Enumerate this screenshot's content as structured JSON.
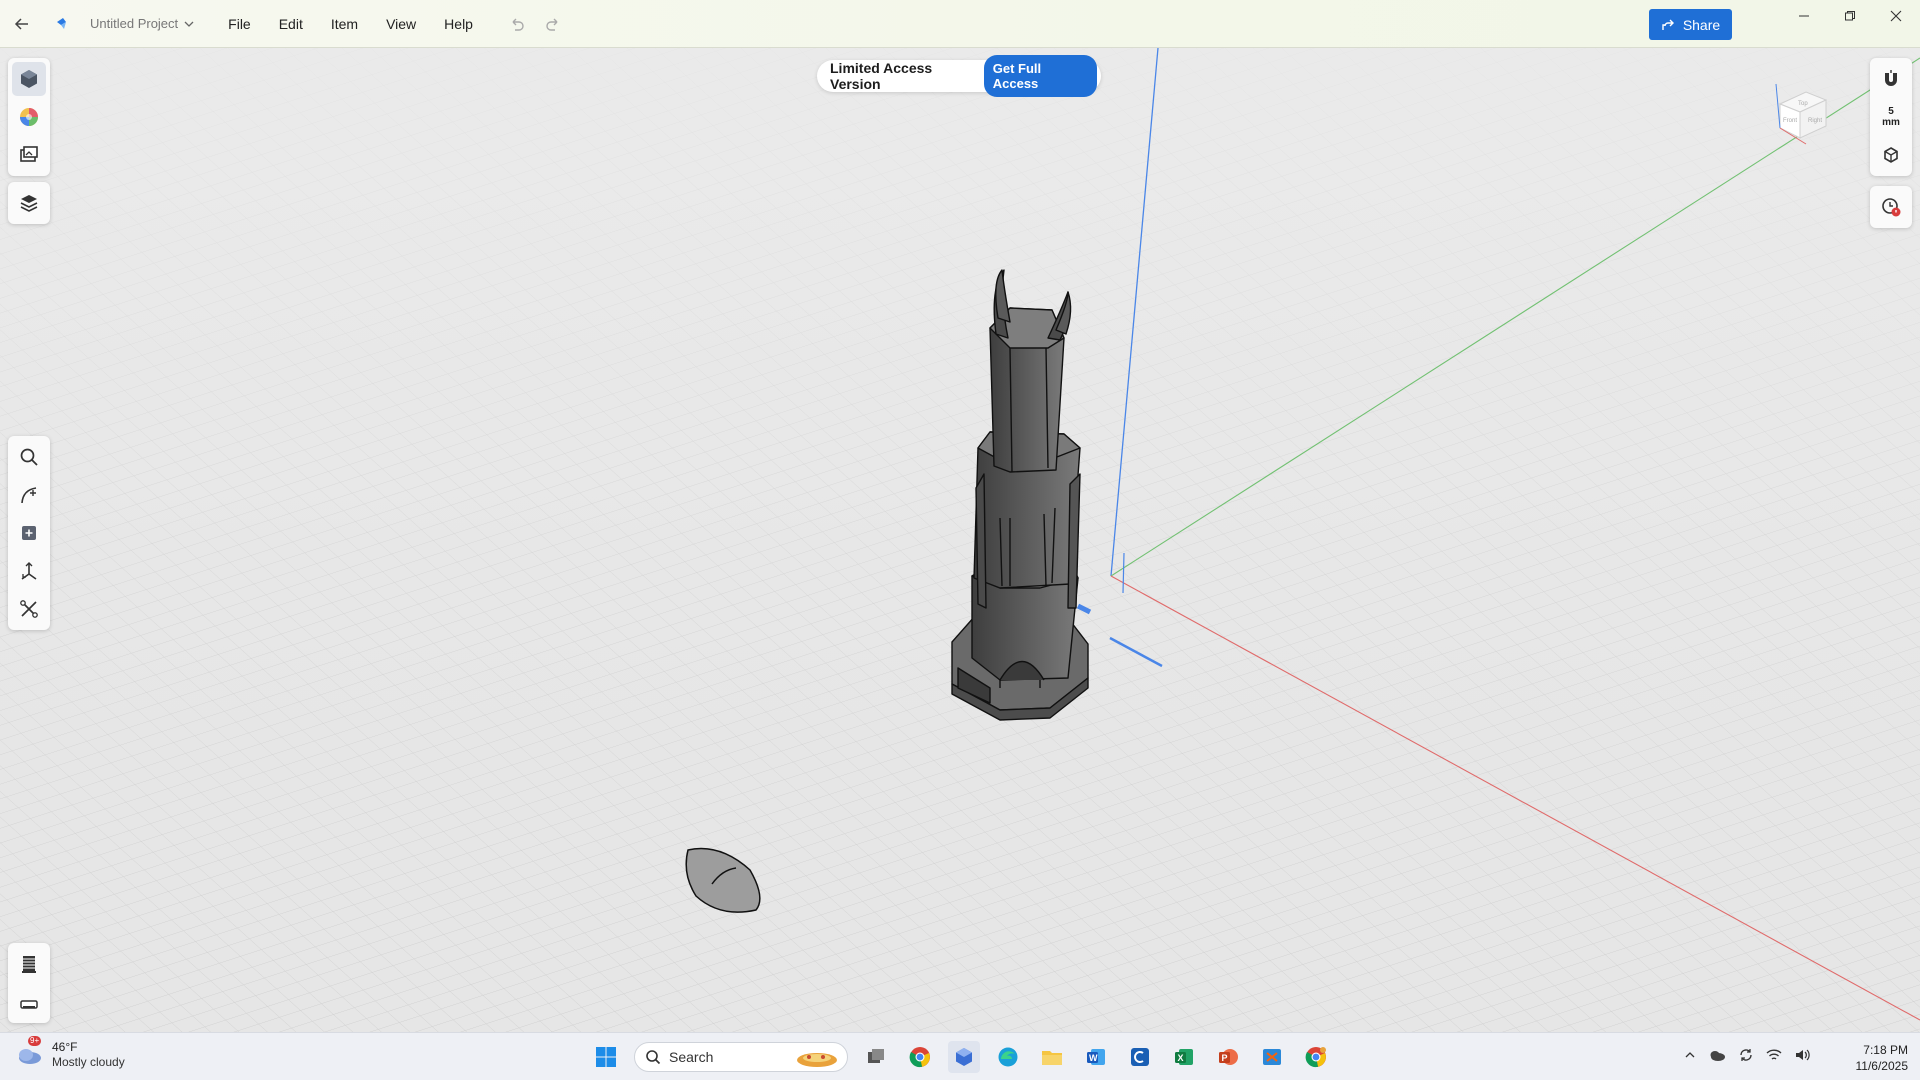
{
  "titlebar": {
    "project_name": "Untitled Project",
    "menu": [
      "File",
      "Edit",
      "Item",
      "View",
      "Help"
    ],
    "share_label": "Share"
  },
  "viewport": {
    "access_text": "Limited Access Version",
    "access_button": "Get Full Access",
    "grid_unit_value": "5",
    "grid_unit_label": "mm",
    "view_cube_faces": [
      "Top",
      "Front",
      "Right"
    ]
  },
  "left_tools_top": [
    "scene-objects-icon",
    "color-wheel-icon",
    "image-layers-icon"
  ],
  "left_tools_mid": [
    "layers-icon"
  ],
  "left_tools_nav": [
    "search-icon",
    "sketch-curve-icon",
    "add-shape-icon",
    "transform-icon",
    "cut-tools-icon"
  ],
  "left_tools_bottom": [
    "print-bed-icon",
    "export-icon"
  ],
  "colors": {
    "accent": "#1f6fd6",
    "axis_x": "#e06b6b",
    "axis_y": "#72c172",
    "axis_z": "#4a86e8"
  },
  "taskbar": {
    "weather_temp": "46°F",
    "weather_cond": "Mostly cloudy",
    "weather_badge": "9+",
    "search_placeholder": "Search",
    "time": "7:18 PM",
    "date": "11/6/2025"
  }
}
